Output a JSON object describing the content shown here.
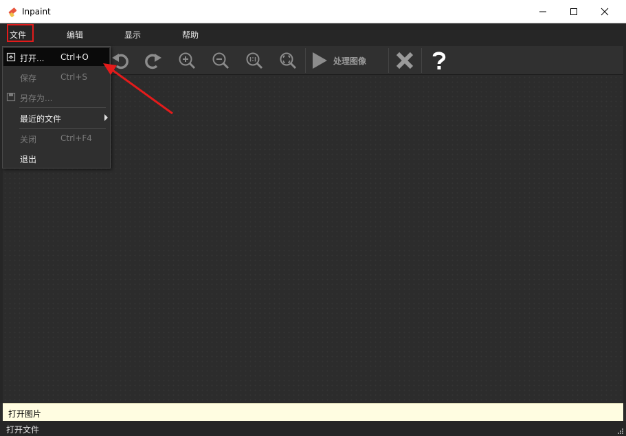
{
  "window": {
    "title": "Inpaint",
    "accent_red": "#e41b1b"
  },
  "menubar": {
    "items": [
      "文件",
      "编辑",
      "显示",
      "帮助"
    ]
  },
  "toolbar": {
    "process_label": "处理图像",
    "buttons": [
      "undo-icon",
      "redo-icon",
      "zoom-in-icon",
      "zoom-out-icon",
      "actual-size-icon",
      "fit-screen-icon",
      "play-icon",
      "close-x-icon",
      "help-icon"
    ]
  },
  "file_menu": {
    "items": [
      {
        "label": "打开...",
        "shortcut": "Ctrl+O",
        "enabled": true,
        "icon": "open-folder-icon"
      },
      {
        "label": "保存",
        "shortcut": "Ctrl+S",
        "enabled": false
      },
      {
        "label": "另存为...",
        "shortcut": "",
        "enabled": false,
        "icon": "floppy-icon"
      },
      {
        "label": "最近的文件",
        "shortcut": "",
        "enabled": true,
        "submenu": true
      },
      {
        "label": "关闭",
        "shortcut": "Ctrl+F4",
        "enabled": false
      },
      {
        "label": "退出",
        "shortcut": "",
        "enabled": true
      }
    ]
  },
  "hint_bar": {
    "text": "打开图片"
  },
  "status_bar": {
    "text": "打开文件"
  }
}
